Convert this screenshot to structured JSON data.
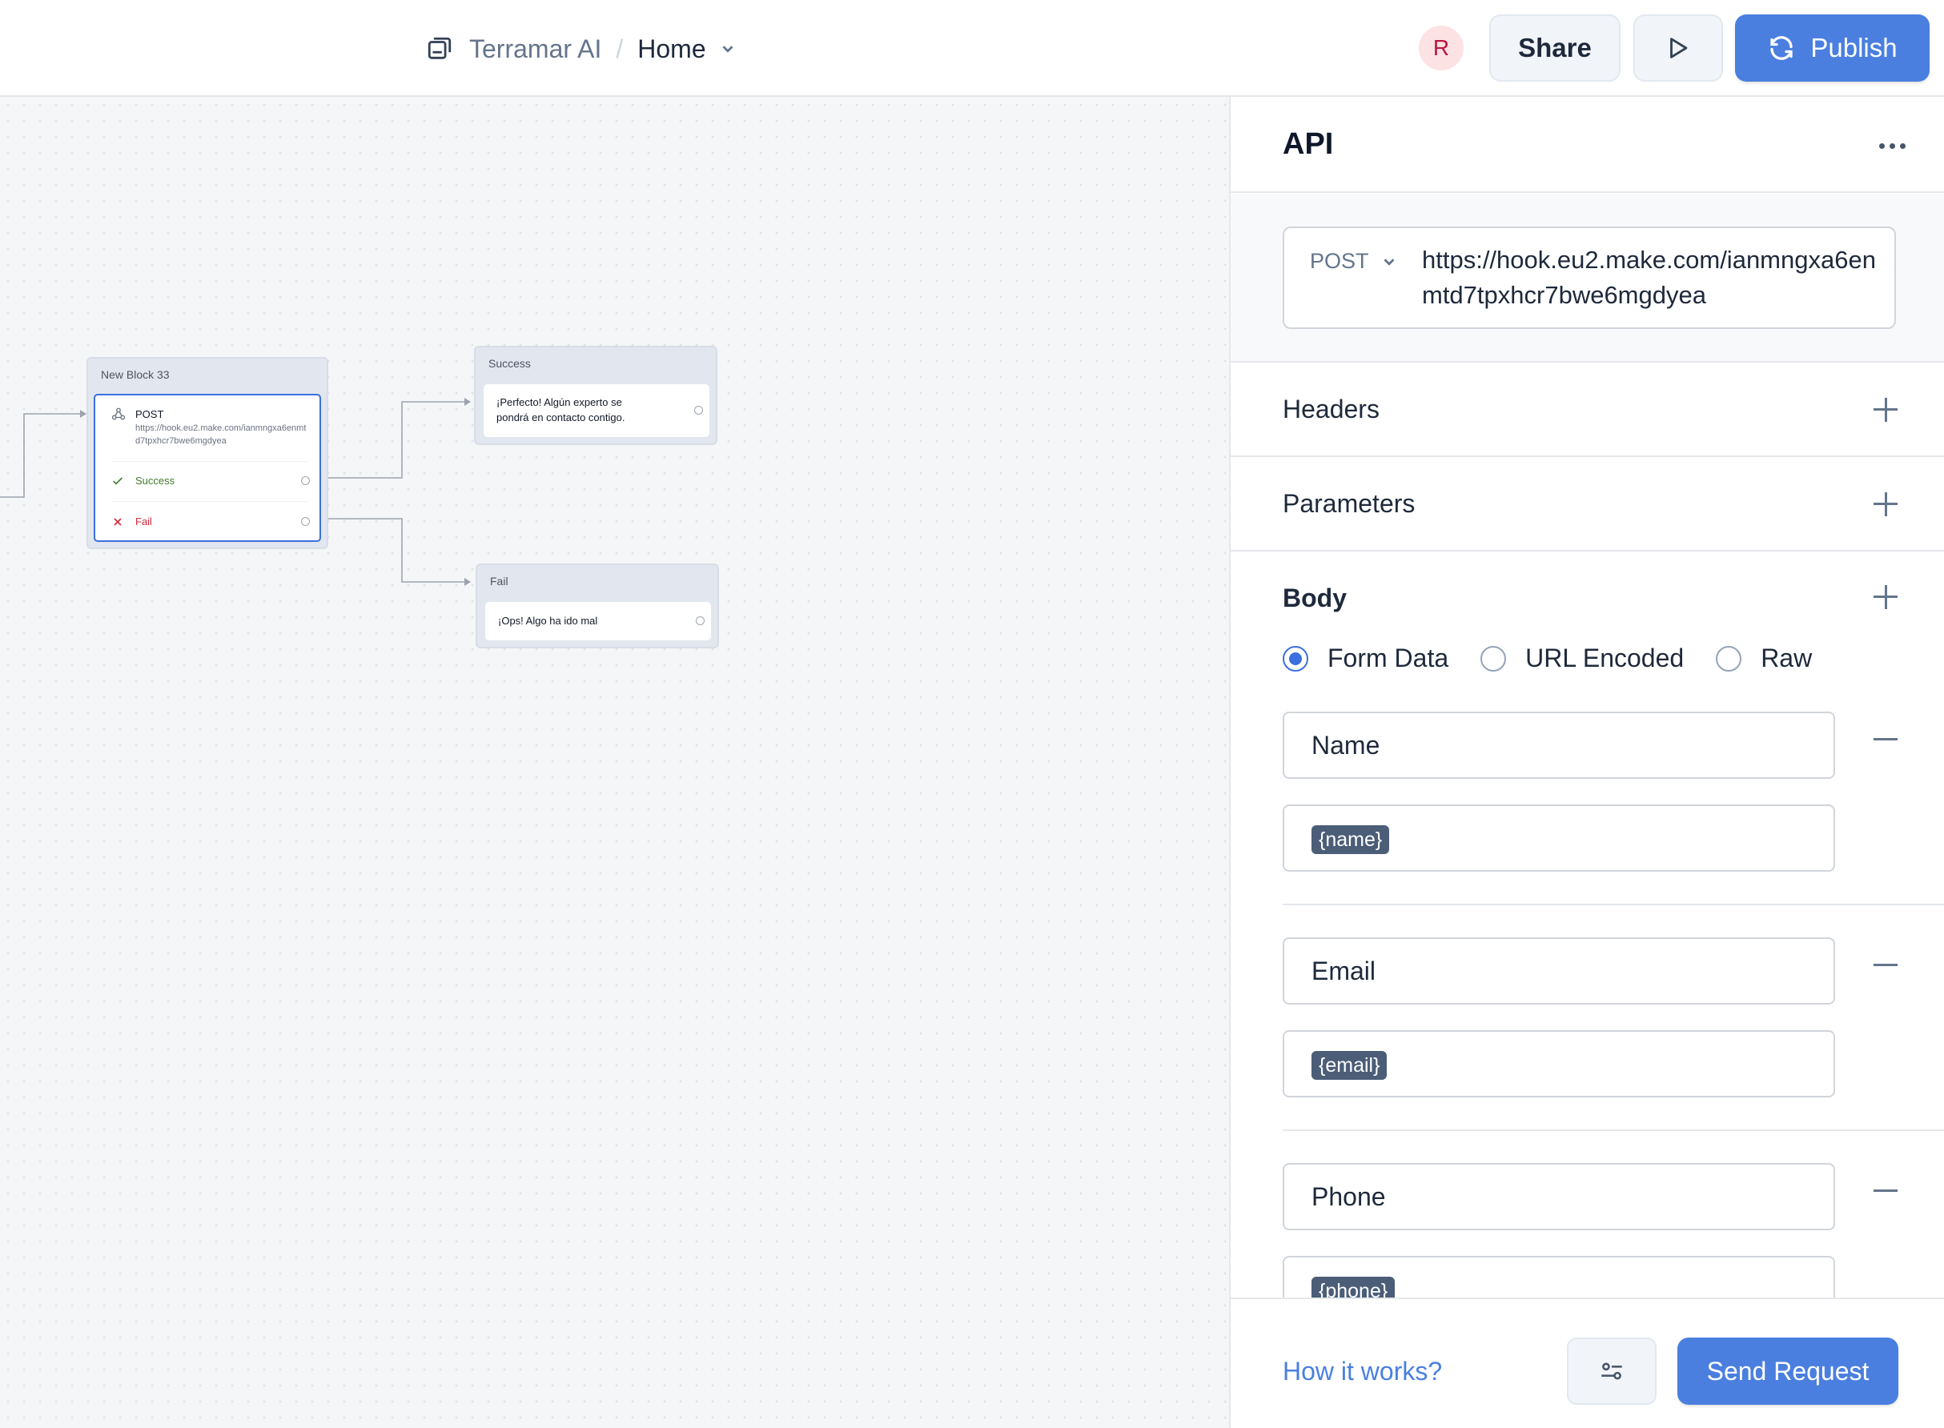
{
  "header": {
    "workspace": "Terramar AI",
    "separator": "/",
    "page": "Home",
    "avatar_initial": "R",
    "share_label": "Share",
    "publish_label": "Publish"
  },
  "canvas": {
    "api_block": {
      "title": "New Block 33",
      "method": "POST",
      "url": "https://hook.eu2.make.com/ianmngxa6enmtd7tpxhcr7bwe6mgdyea",
      "success_label": "Success",
      "fail_label": "Fail"
    },
    "success_block": {
      "title": "Success",
      "message_line1": "¡Perfecto! Algún experto se",
      "message_line2": "pondrá en contacto contigo."
    },
    "fail_block": {
      "title": "Fail",
      "message": "¡Ops! Algo ha ido mal"
    }
  },
  "panel": {
    "title": "API",
    "method": "POST",
    "url": "https://hook.eu2.make.com/ianmngxa6enmtd7tpxhcr7bwe6mgdyea",
    "headers_label": "Headers",
    "parameters_label": "Parameters",
    "body_label": "Body",
    "body_types": [
      "Form Data",
      "URL Encoded",
      "Raw"
    ],
    "selected_body_type": "Form Data",
    "fields": [
      {
        "key": "Name",
        "value": "{name}"
      },
      {
        "key": "Email",
        "value": "{email}"
      },
      {
        "key": "Phone",
        "value": "{phone}"
      }
    ],
    "how_it_works": "How it works?",
    "send_label": "Send Request"
  },
  "colors": {
    "accent": "#4a7fdf",
    "success": "#3f7a2a",
    "fail": "#d9263a",
    "tag": "#4b5d77"
  }
}
